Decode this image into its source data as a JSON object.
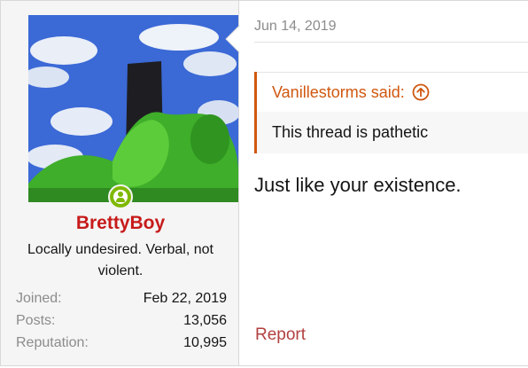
{
  "user": {
    "name": "BrettyBoy",
    "title": "Locally undesired. Verbal, not violent.",
    "online_status": "online-icon",
    "stats": [
      {
        "label": "Joined:",
        "value": "Feb 22, 2019"
      },
      {
        "label": "Posts:",
        "value": "13,056"
      },
      {
        "label": "Reputation:",
        "value": "10,995"
      }
    ]
  },
  "post": {
    "date": "Jun 14, 2019",
    "quote": {
      "author_line": "Vanillestorms said:",
      "body": "This thread is pathetic",
      "icon": "arrow-up-circle-icon"
    },
    "message": "Just like your existence.",
    "report_label": "Report"
  },
  "colors": {
    "username": "#c71a1a",
    "quote_accent": "#d0570f",
    "report_link": "#b34040",
    "online": "#7fb900",
    "muted": "#8c8c8c"
  }
}
